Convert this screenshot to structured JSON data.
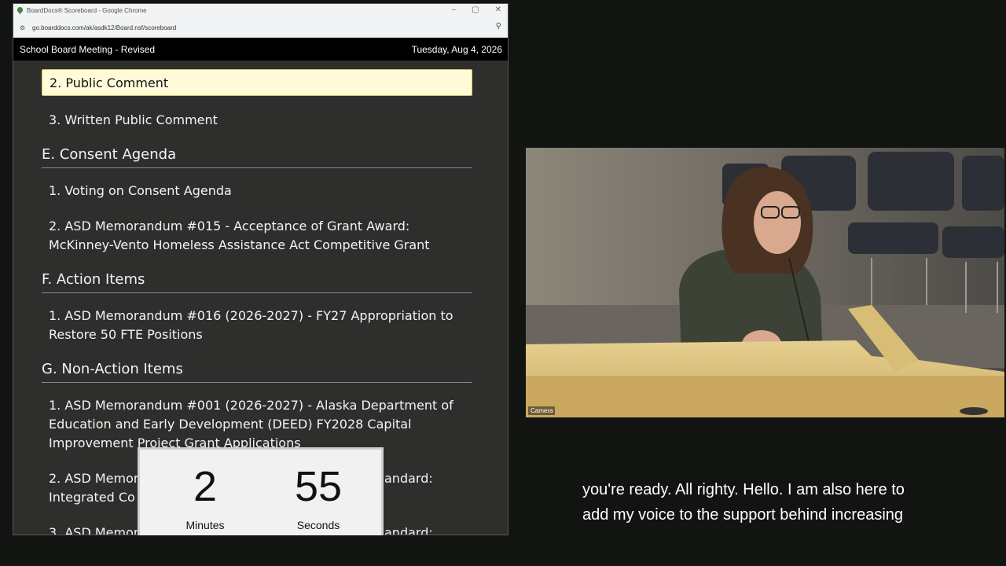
{
  "browser": {
    "tab_title": "BoardDocs® Scoreboard - Google Chrome",
    "url": "go.boarddocs.com/ak/asdk12/Board.nsf/scoreboard",
    "minimize": "–",
    "maximize": "▢",
    "close": "✕"
  },
  "meeting": {
    "title": "School Board Meeting - Revised",
    "date": "Tuesday, Aug 4, 2026"
  },
  "agenda": {
    "active_item": "2. Public Comment",
    "items": [
      "3. Written Public Comment",
      "1. Voting on Consent Agenda",
      "2. ASD Memorandum #015 - Acceptance of Grant Award:",
      "McKinney-Vento Homeless Assistance Act Competitive Grant",
      "1. ASD Memorandum #016 (2026-2027) - FY27 Appropriation to",
      "Restore 50 FTE Positions",
      "1. ASD Memorandum #001 (2026-2027) - Alaska Department of",
      "Education and Early Development (DEED) FY2028 Capital",
      "Improvement Project Grant Applications",
      "2. ASD Memor",
      "andard:",
      "Integrated Co",
      "3. ASD Memor",
      "andard:"
    ],
    "sections": [
      "E. Consent Agenda",
      "F. Action Items",
      "G. Non-Action Items"
    ]
  },
  "timer": {
    "minutes": "2",
    "minutes_label": "Minutes",
    "seconds": "55",
    "seconds_label": "Seconds"
  },
  "camera": {
    "label": "Camera"
  },
  "caption": {
    "line1": "you're ready. All righty. Hello. I am also here to",
    "line2": "add my voice to the support behind increasing"
  },
  "colors": {
    "active_item_bg": "#fffbd8",
    "page_bg": "#121412",
    "agenda_bg": "#2e2f2d"
  }
}
